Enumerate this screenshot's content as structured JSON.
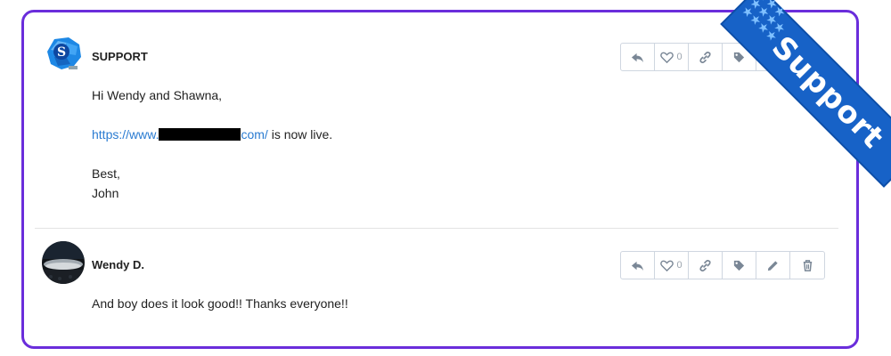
{
  "posts": [
    {
      "author": "SUPPORT",
      "avatar_icon": "support-logo-avatar",
      "paragraphs": {
        "greeting": "Hi Wendy and Shawna,",
        "link_start": "https://www.",
        "link_end": "com/",
        "link_suffix": " is now live.",
        "signoff": "Best,",
        "name": "John"
      },
      "like_count": "0"
    },
    {
      "author": "Wendy D.",
      "avatar_icon": "concert-crowd-avatar",
      "text": "And boy does it look good!! Thanks everyone!!",
      "like_count": "0"
    }
  ],
  "ribbon": {
    "label": "Support",
    "color": "#1762c7"
  },
  "accent_color": "#6a2ddb",
  "link_color": "#2a7bd1"
}
